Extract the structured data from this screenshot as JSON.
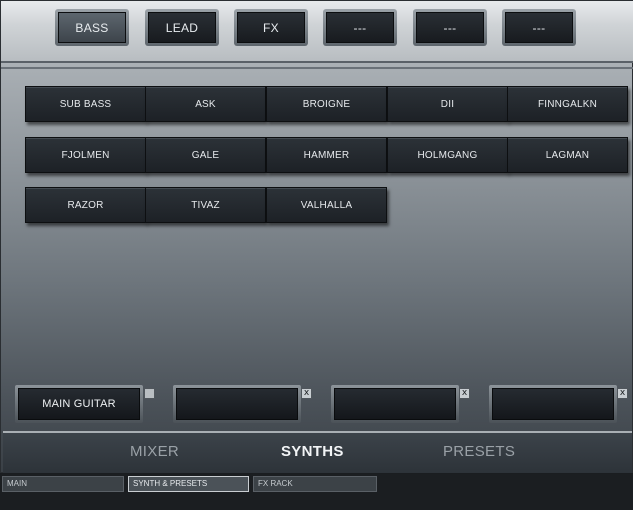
{
  "categories": [
    {
      "label": "BASS",
      "active": true
    },
    {
      "label": "LEAD",
      "active": false
    },
    {
      "label": "FX",
      "active": false
    },
    {
      "label": "---",
      "active": false
    },
    {
      "label": "---",
      "active": false
    },
    {
      "label": "---",
      "active": false
    }
  ],
  "presets": [
    "SUB BASS",
    "ASK",
    "BROIGNE",
    "DII",
    "FINNGALKN",
    "FJOLMEN",
    "GALE",
    "HAMMER",
    "HOLMGANG",
    "LAGMAN",
    "RAZOR",
    "TIVAZ",
    "VALHALLA"
  ],
  "slots": [
    {
      "label": "MAIN GUITAR",
      "control": "square"
    },
    {
      "label": "",
      "control": "x"
    },
    {
      "label": "",
      "control": "x"
    },
    {
      "label": "",
      "control": "x"
    }
  ],
  "slot_close_glyph": "x",
  "nav": {
    "mixer": "MIXER",
    "synths": "SYNTHS",
    "presets": "PRESETS",
    "active": "synths"
  },
  "tabs": [
    {
      "label": "MAIN",
      "active": false
    },
    {
      "label": "SYNTH & PRESETS",
      "active": true
    },
    {
      "label": "FX RACK",
      "active": false
    }
  ]
}
